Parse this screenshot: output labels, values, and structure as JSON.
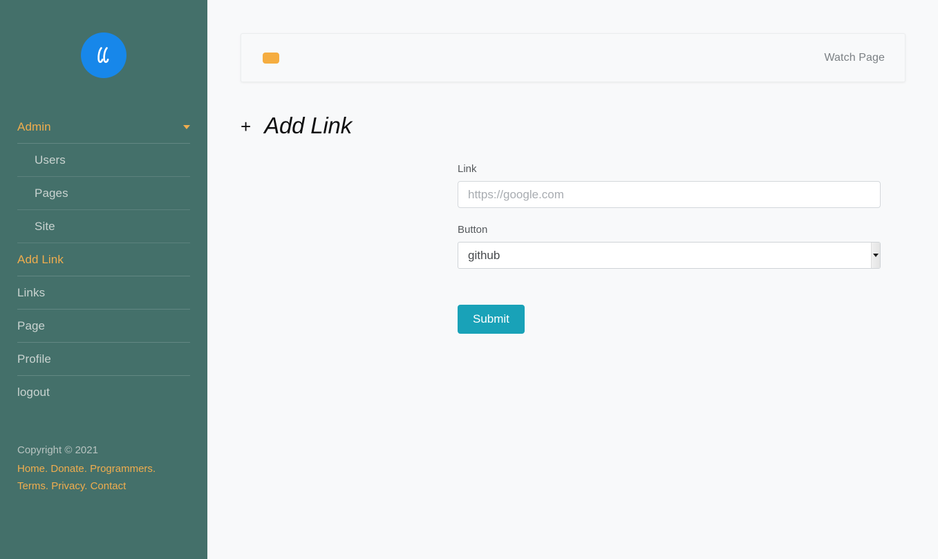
{
  "sidebar": {
    "brand": {
      "icon": "script-ll-logo-icon",
      "bg_color": "#1787ea"
    },
    "nav": [
      {
        "label": "Admin",
        "accent": true,
        "sub": false,
        "caret": true
      },
      {
        "label": "Users",
        "accent": false,
        "sub": true,
        "caret": false
      },
      {
        "label": "Pages",
        "accent": false,
        "sub": true,
        "caret": false
      },
      {
        "label": "Site",
        "accent": false,
        "sub": true,
        "caret": false
      },
      {
        "label": "Add Link",
        "accent": true,
        "sub": false,
        "caret": false
      },
      {
        "label": "Links",
        "accent": false,
        "sub": false,
        "caret": false
      },
      {
        "label": "Page",
        "accent": false,
        "sub": false,
        "caret": false
      },
      {
        "label": "Profile",
        "accent": false,
        "sub": false,
        "caret": false
      },
      {
        "label": "logout",
        "accent": false,
        "sub": false,
        "caret": false
      }
    ],
    "footer": {
      "copyright": "Copyright © 2021",
      "links_row1": [
        "Home",
        "Donate",
        "Programmers"
      ],
      "links_row2": [
        "Terms",
        "Privacy",
        "Contact"
      ],
      "separator": "."
    },
    "colors": {
      "background": "#44706a",
      "accent": "#f0ad4e",
      "text": "#c9d3d0"
    }
  },
  "topnav": {
    "brand_box_color": "#f5ad40",
    "watch_page_label": "Watch Page"
  },
  "page": {
    "heading_plus": "+",
    "heading_title": "Add Link"
  },
  "form": {
    "link": {
      "label": "Link",
      "value": "",
      "placeholder": "https://google.com"
    },
    "button": {
      "label": "Button",
      "selected": "github",
      "options": [
        "github"
      ]
    },
    "submit_label": "Submit",
    "submit_color": "#19a2b8"
  }
}
